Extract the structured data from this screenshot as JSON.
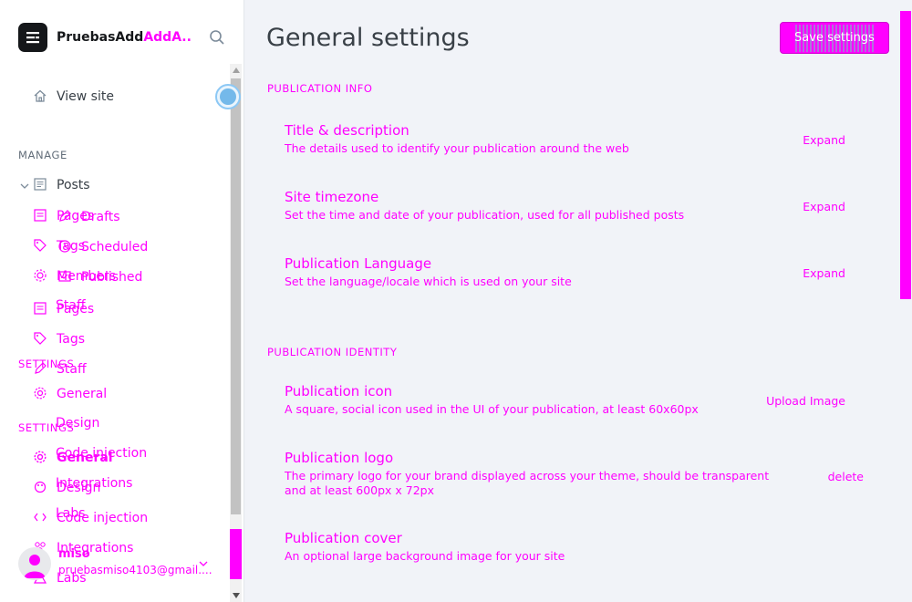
{
  "sidebar": {
    "brand_prefix": "PruebasAdd",
    "brand_suffix": "AddA...",
    "view_site": "View site",
    "manage_label": "MANAGE",
    "posts": "Posts",
    "under_labels": [
      "Pages",
      "Tags",
      "Members",
      "Staff"
    ],
    "sub_items": [
      "Drafts",
      "Scheduled",
      "Published"
    ],
    "items": [
      "Pages",
      "Tags",
      "Staff"
    ],
    "settings_label_1": "SETTINGS",
    "settings_items_1": [
      "General",
      "Design",
      "Code injection",
      "Integrations",
      "Labs"
    ],
    "settings_label_2": "SETTINGS",
    "settings_items_2": [
      "General",
      "Design",
      "Code injection",
      "Integrations",
      "Labs"
    ]
  },
  "user": {
    "name": "miso",
    "email": "pruebasmiso4103@gmail...."
  },
  "main": {
    "title": "General settings",
    "save_label": "Save settings",
    "sections": [
      {
        "label": "PUBLICATION INFO",
        "items": [
          {
            "title": "Title & description",
            "description": "The details used to identify your publication around the web",
            "action": "Expand"
          },
          {
            "title": "Site timezone",
            "description": "Set the time and date of your publication, used for all published posts",
            "action": "Expand"
          },
          {
            "title": "Publication Language",
            "description": "Set the language/locale which is used on your site",
            "action": "Expand"
          }
        ]
      },
      {
        "label": "PUBLICATION IDENTITY",
        "items": [
          {
            "title": "Publication icon",
            "description": "A square, social icon used in the UI of your publication, at least 60x60px",
            "action": "Upload Image"
          },
          {
            "title": "Publication logo",
            "description": "The primary logo for your brand displayed across your theme, should be transparent and at least 600px x 72px",
            "action": "delete"
          },
          {
            "title": "Publication cover",
            "description": "An optional large background image for your site",
            "action": ""
          }
        ]
      }
    ]
  },
  "colors": {
    "accent": "#ff00ff",
    "sidebar_bg": "#ffffff",
    "main_bg": "#f1f3f8",
    "text_dark": "#394047"
  },
  "icons": [
    "editor-logo-icon",
    "search-icon",
    "home-icon",
    "chevron-down-icon",
    "posts-icon",
    "pages-icon",
    "tag-icon",
    "members-icon",
    "staff-icon",
    "gear-icon",
    "design-icon",
    "code-icon",
    "integrations-icon",
    "labs-icon",
    "avatar-icon"
  ]
}
